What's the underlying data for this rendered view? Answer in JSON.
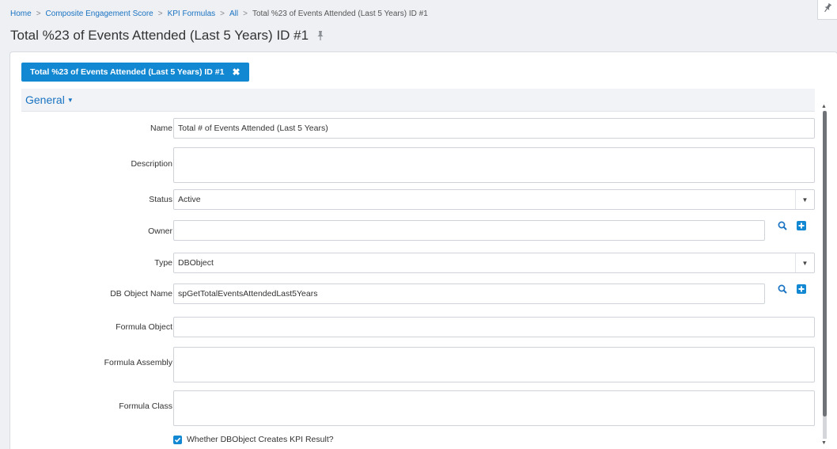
{
  "breadcrumb": {
    "home": "Home",
    "engagement": "Composite Engagement Score",
    "formulas": "KPI Formulas",
    "all": "All",
    "current": "Total %23 of Events Attended (Last 5 Years) ID #1",
    "separator": ">"
  },
  "page": {
    "title": "Total %23 of Events Attended (Last 5 Years) ID #1",
    "pin_icon": "pin-icon"
  },
  "tab": {
    "label": "Total %23 of Events Attended (Last 5 Years) ID #1",
    "close_glyph": "✖"
  },
  "section": {
    "title": "General",
    "caret": "▼"
  },
  "form": {
    "name": {
      "label": "Name",
      "value": "Total # of Events Attended (Last 5 Years)"
    },
    "description": {
      "label": "Description",
      "value": ""
    },
    "status": {
      "label": "Status",
      "value": "Active"
    },
    "owner": {
      "label": "Owner",
      "value": ""
    },
    "type": {
      "label": "Type",
      "value": "DBObject"
    },
    "db_object_name": {
      "label": "DB Object Name",
      "value": "spGetTotalEventsAttendedLast5Years"
    },
    "formula_object": {
      "label": "Formula Object",
      "value": ""
    },
    "formula_assembly": {
      "label": "Formula Assembly",
      "value": ""
    },
    "formula_class": {
      "label": "Formula Class",
      "value": ""
    },
    "creates_kpi_result": {
      "label": "Whether DBObject Creates KPI Result?",
      "checked": true
    }
  },
  "colors": {
    "accent": "#1388d2",
    "link": "#1a73c2",
    "background": "#eef0f4"
  }
}
